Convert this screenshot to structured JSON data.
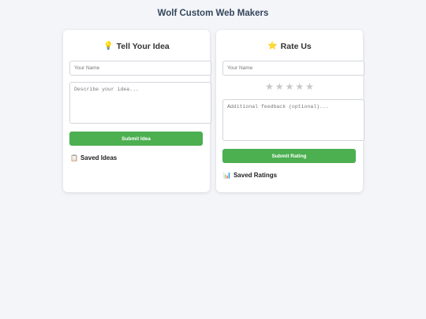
{
  "page": {
    "title": "Wolf Custom Web Makers"
  },
  "idea_card": {
    "icon": "lightbulb-icon",
    "icon_glyph": "💡",
    "title": "Tell Your Idea",
    "name_placeholder": "Your Name",
    "idea_placeholder": "Describe your idea...",
    "submit_label": "Submit Idea",
    "saved_icon": "clipboard-icon",
    "saved_icon_glyph": "📋",
    "saved_label": "Saved Ideas"
  },
  "rate_card": {
    "icon": "star-icon",
    "icon_glyph": "⭐",
    "title": "Rate Us",
    "name_placeholder": "Your Name",
    "stars": [
      "★",
      "★",
      "★",
      "★",
      "★"
    ],
    "rating_value": 0,
    "feedback_placeholder": "Additional feedback (optional)...",
    "submit_label": "Submit Rating",
    "saved_icon": "bar-chart-icon",
    "saved_icon_glyph": "📊",
    "saved_label": "Saved Ratings"
  },
  "colors": {
    "background": "#f4f5f9",
    "button": "#4caf50",
    "star_inactive": "#c8c8c8",
    "title": "#34465c"
  }
}
